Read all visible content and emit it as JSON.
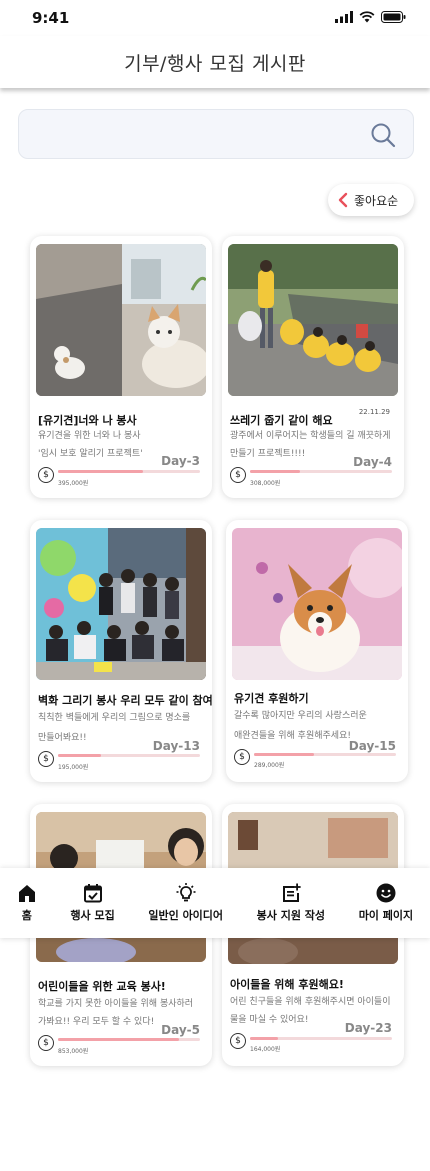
{
  "status_bar": {
    "time": "9:41"
  },
  "header": {
    "title": "기부/행사 모집 게시판"
  },
  "search": {
    "placeholder": ""
  },
  "sort": {
    "label": "좋아요순"
  },
  "cards": [
    {
      "title": "[유기견]너와 나 봉사",
      "desc_1": "유기견을 위한 너와 나 봉사",
      "desc_2": "'임시 보호 알리기 프로젝트'",
      "date": "",
      "day": "Day-3",
      "amount": "395,000원",
      "progress": 0.6
    },
    {
      "title": "쓰레기 줍기 같이 해요",
      "desc_1": "광주에서 이루어지는 학생들의 길 깨끗하게",
      "desc_2": "만들기 프로젝트!!!!",
      "date": "22.11.29",
      "day": "Day-4",
      "amount": "308,000원",
      "progress": 0.35
    },
    {
      "title": "벽화 그리기 봉사 우리 모두 같이 참여!",
      "desc_1": "칙칙한 벽들에게 우리의 그림으로 명소를",
      "desc_2": "만들어봐요!!",
      "date": "",
      "day": "Day-13",
      "amount": "195,000원",
      "progress": 0.3
    },
    {
      "title": "유기견 후원하기",
      "desc_1": "갈수록 많아지만 우리의 사랑스러운",
      "desc_2": "애완견들을 위해 후원해주세요!",
      "date": "",
      "day": "Day-15",
      "amount": "289,000원",
      "progress": 0.42
    },
    {
      "title": "어린이들을 위한 교육 봉사!",
      "desc_1": "학교를 가지 못한 아이들을 위해 봉사하러",
      "desc_2": "가봐요!! 우리 모두 할 수 있다!",
      "date": "",
      "day": "Day-5",
      "amount": "853,000원",
      "progress": 0.85
    },
    {
      "title": "아이들을 위해 후원해요!",
      "desc_1": "어린 친구들을 위해 후원해주시면 아이들이",
      "desc_2": "물을 마실 수 있어요!",
      "date": "",
      "day": "Day-23",
      "amount": "164,000원",
      "progress": 0.2
    }
  ],
  "nav": [
    {
      "label": "홈",
      "icon": "home-icon"
    },
    {
      "label": "행사 모집",
      "icon": "calendar-icon"
    },
    {
      "label": "일반인 아이디어",
      "icon": "lightbulb-icon"
    },
    {
      "label": "봉사 지원 작성",
      "icon": "note-add-icon"
    },
    {
      "label": "마이 페이지",
      "icon": "smiley-icon"
    }
  ],
  "colors": {
    "accent": "#e8505b",
    "progress": "#f3a1a8",
    "progress_track": "#f3d9db"
  }
}
